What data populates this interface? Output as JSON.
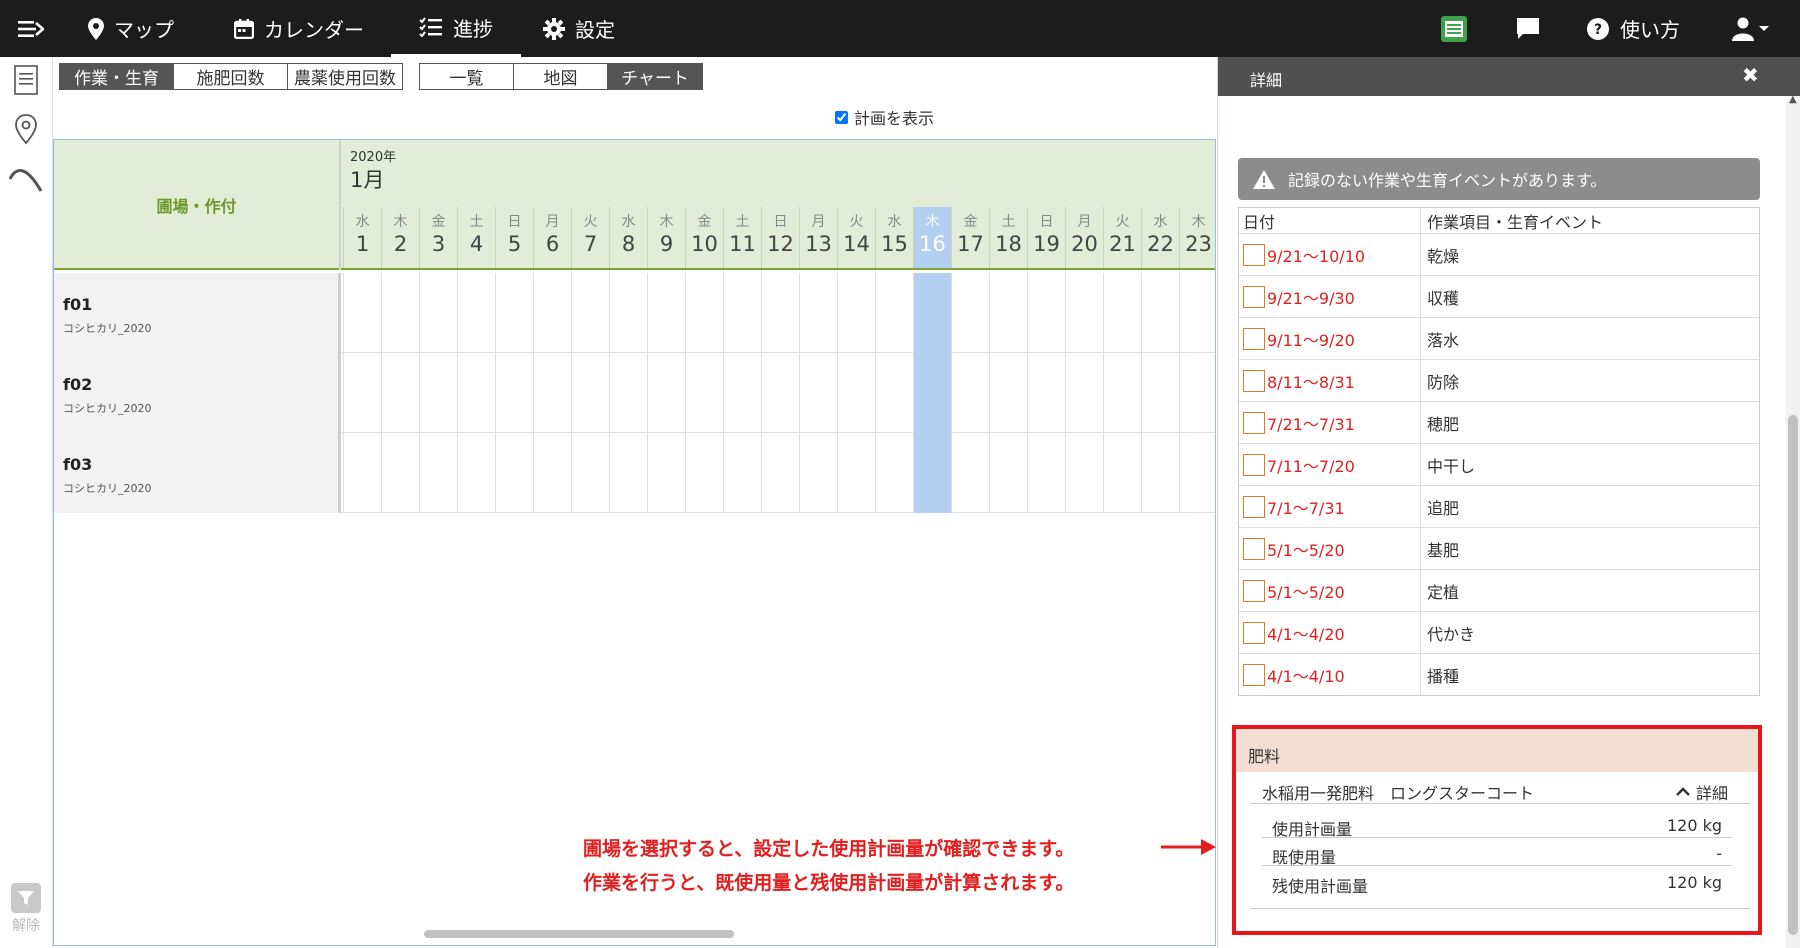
{
  "nav": {
    "menu_icon": "menu-arrow-icon",
    "items": [
      {
        "label": "マップ",
        "icon": "map-pin-icon"
      },
      {
        "label": "カレンダー",
        "icon": "calendar-icon"
      },
      {
        "label": "進捗",
        "icon": "checklist-icon",
        "active": true
      },
      {
        "label": "設定",
        "icon": "gear-icon"
      }
    ],
    "right": {
      "help_label": "使い方",
      "icons": [
        "sheet-icon",
        "chat-icon",
        "help-icon",
        "user-icon"
      ]
    }
  },
  "sidebar": {
    "filter_label": "解除",
    "icons": [
      "list-icon",
      "pin-outline-icon",
      "curve-icon",
      "filter-icon"
    ]
  },
  "tabs_type": [
    "作業・生育",
    "施肥回数",
    "農薬使用回数"
  ],
  "tabs_view": [
    "一覧",
    "地図",
    "チャート"
  ],
  "show_plan_label": "計画を表示",
  "show_plan_checked": true,
  "gantt": {
    "field_header": "圃場・作付",
    "year": "2020年",
    "month": "1月",
    "days": [
      {
        "dow": "水",
        "d": "1"
      },
      {
        "dow": "木",
        "d": "2"
      },
      {
        "dow": "金",
        "d": "3"
      },
      {
        "dow": "土",
        "d": "4"
      },
      {
        "dow": "日",
        "d": "5"
      },
      {
        "dow": "月",
        "d": "6"
      },
      {
        "dow": "火",
        "d": "7"
      },
      {
        "dow": "水",
        "d": "8"
      },
      {
        "dow": "木",
        "d": "9"
      },
      {
        "dow": "金",
        "d": "10"
      },
      {
        "dow": "土",
        "d": "11"
      },
      {
        "dow": "日",
        "d": "12"
      },
      {
        "dow": "月",
        "d": "13"
      },
      {
        "dow": "火",
        "d": "14"
      },
      {
        "dow": "水",
        "d": "15"
      },
      {
        "dow": "木",
        "d": "16",
        "today": true
      },
      {
        "dow": "金",
        "d": "17"
      },
      {
        "dow": "土",
        "d": "18"
      },
      {
        "dow": "日",
        "d": "19"
      },
      {
        "dow": "月",
        "d": "20"
      },
      {
        "dow": "火",
        "d": "21"
      },
      {
        "dow": "水",
        "d": "22"
      },
      {
        "dow": "木",
        "d": "23"
      }
    ],
    "rows": [
      {
        "field": "f01",
        "crop": "コシヒカリ_2020"
      },
      {
        "field": "f02",
        "crop": "コシヒカリ_2020"
      },
      {
        "field": "f03",
        "crop": "コシヒカリ_2020"
      }
    ]
  },
  "detail": {
    "title": "詳細",
    "close_icon": "close-icon",
    "warning": "記録のない作業や生育イベントがあります。",
    "table_headers": [
      "日付",
      "作業項目・生育イベント"
    ],
    "events": [
      {
        "date": "9/21〜10/10",
        "event": "乾燥"
      },
      {
        "date": "9/21〜9/30",
        "event": "収穫"
      },
      {
        "date": "9/11〜9/20",
        "event": "落水"
      },
      {
        "date": "8/11〜8/31",
        "event": "防除"
      },
      {
        "date": "7/21〜7/31",
        "event": "穂肥"
      },
      {
        "date": "7/11〜7/20",
        "event": "中干し"
      },
      {
        "date": "7/1〜7/31",
        "event": "追肥"
      },
      {
        "date": "5/1〜5/20",
        "event": "基肥"
      },
      {
        "date": "5/1〜5/20",
        "event": "定植"
      },
      {
        "date": "4/1〜4/20",
        "event": "代かき"
      },
      {
        "date": "4/1〜4/10",
        "event": "播種"
      }
    ],
    "fertilizer": {
      "header": "肥料",
      "name": "水稲用一発肥料　ロングスターコート",
      "detail_label": "詳細",
      "rows": [
        {
          "label": "使用計画量",
          "value": "120 kg"
        },
        {
          "label": "既使用量",
          "value": "-"
        },
        {
          "label": "残使用計画量",
          "value": "120 kg"
        }
      ]
    }
  },
  "annotation": {
    "line1": "圃場を選択すると、設定した使用計画量が確認できます。",
    "line2": "作業を行うと、既使用量と残使用計画量が計算されます。",
    "color": "#e21f1f"
  }
}
